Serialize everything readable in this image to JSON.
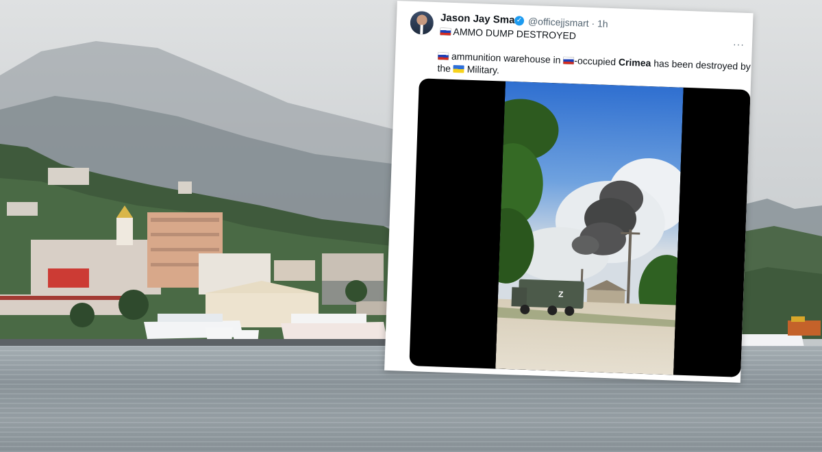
{
  "tweet": {
    "author_name": "Jason Jay Smart",
    "verified_icon": "✓",
    "handle": "@officejjsmart",
    "separator": "·",
    "time": "1h",
    "more_label": "···",
    "headline": "AMMO DUMP DESTROYED",
    "body_part1": "ammunition warehouse in",
    "body_part2": "-occupied",
    "body_bold": "Crimea",
    "body_part3": "has been destroyed by",
    "body_part4": "the",
    "body_part5": "Military.",
    "video": {
      "truck_marking": "Z"
    }
  },
  "colors": {
    "accent": "#1d9bf0",
    "flag_ru": [
      "#ffffff",
      "#1c3fb6",
      "#d52b1e"
    ],
    "flag_ua": [
      "#2e6fd8",
      "#f7d21b"
    ]
  }
}
